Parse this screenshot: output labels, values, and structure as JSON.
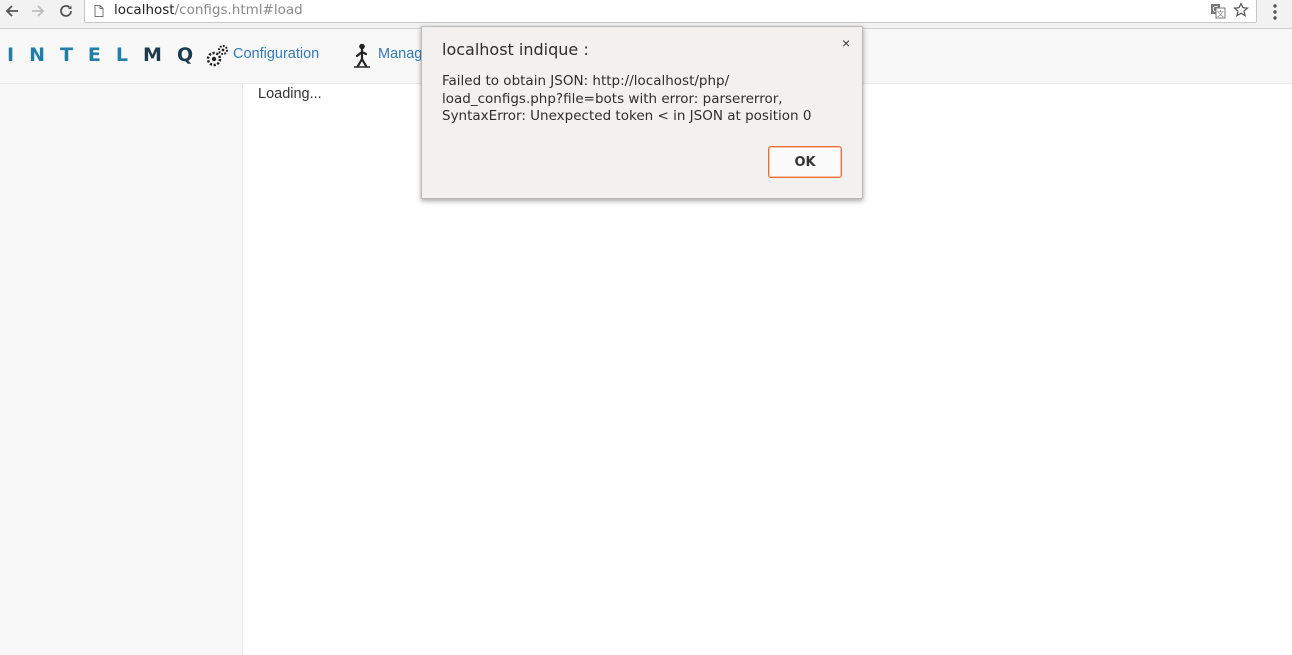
{
  "browser": {
    "url_host": "localhost",
    "url_path": "/configs.html#load"
  },
  "app": {
    "logo_left": "INTEL",
    "logo_right": "MQ",
    "nav": {
      "configuration_label": "Configuration",
      "management_label": "Manag"
    }
  },
  "main": {
    "loading_text": "Loading..."
  },
  "dialog": {
    "title": "localhost indique :",
    "close_glyph": "×",
    "message_lines": [
      "Failed to obtain JSON: http://localhost/php/",
      "load_configs.php?file=bots with error: parsererror,",
      "SyntaxError: Unexpected token < in JSON at position 0"
    ],
    "ok_label": "OK",
    "ok_border_color": "#e76f3a"
  },
  "colors": {
    "link": "#337ab7",
    "logo_blue": "#1f7fa8",
    "logo_dark": "#1d3b4f"
  },
  "icons": {
    "back": "back-arrow-icon",
    "forward": "forward-arrow-icon",
    "reload": "reload-icon",
    "page": "page-icon",
    "translate": "translate-icon",
    "bookmark": "star-icon",
    "menu": "menu-dots-icon",
    "configuration": "gears-icon",
    "management": "person-icon"
  }
}
